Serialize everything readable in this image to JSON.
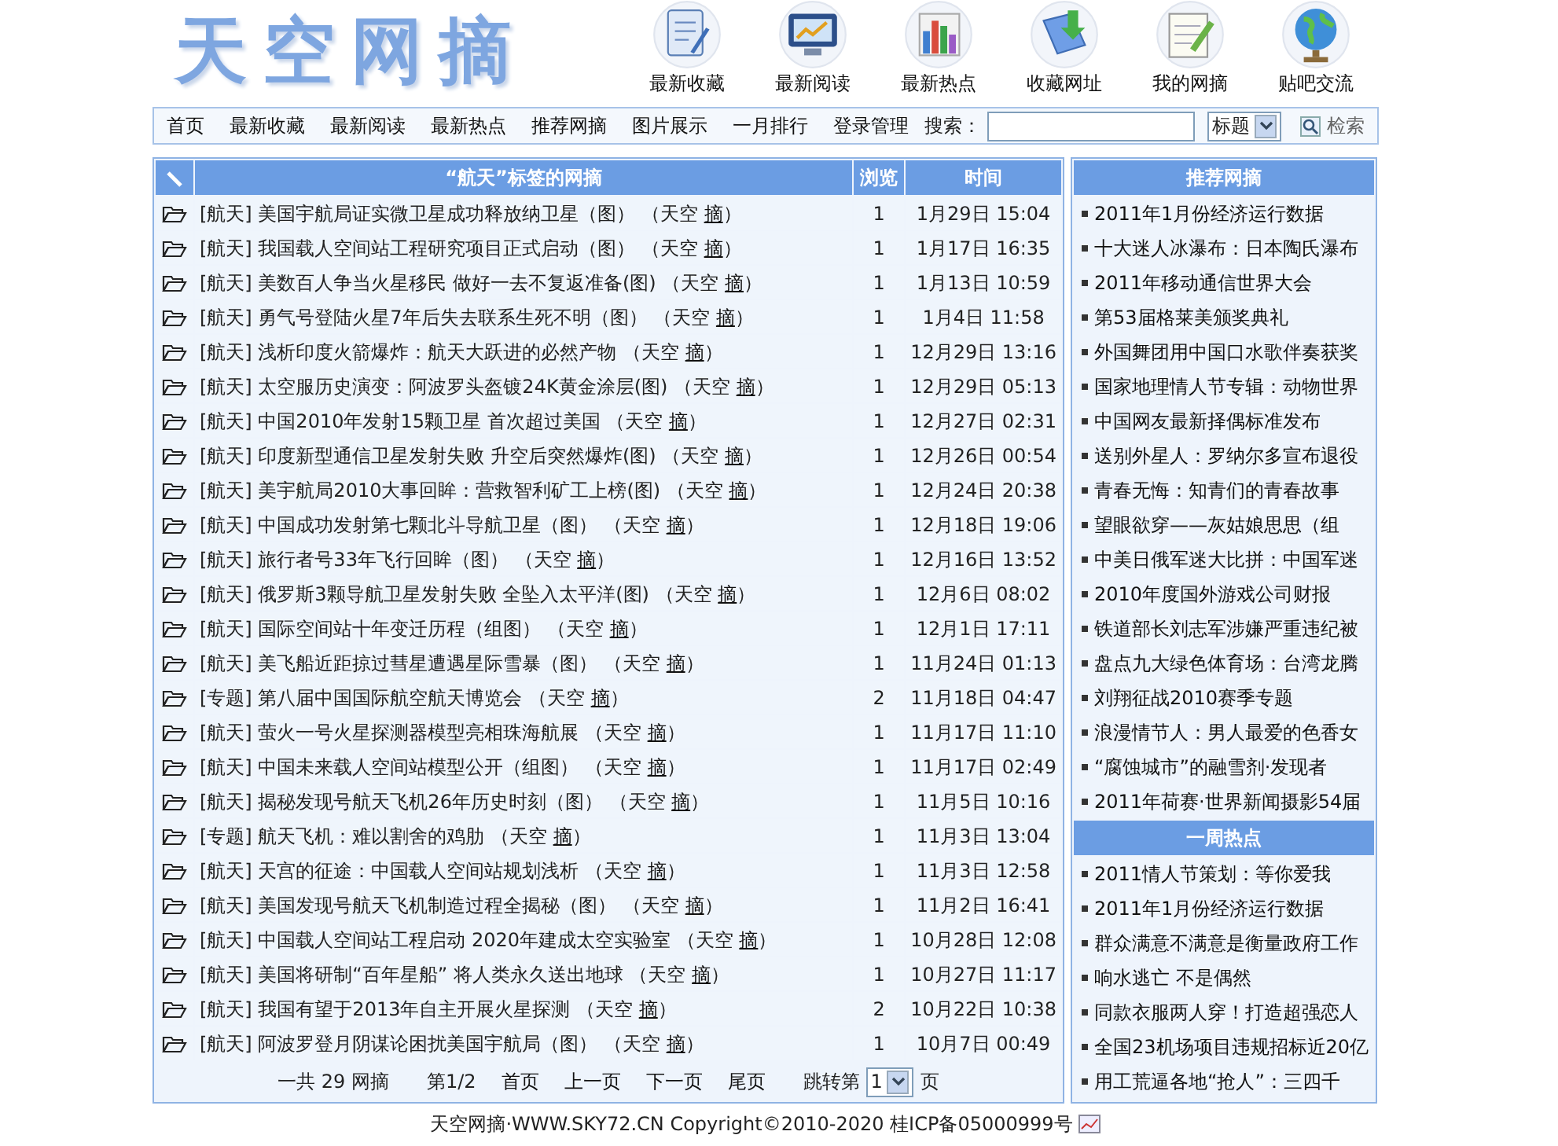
{
  "logo": "天空网摘",
  "quick_links": [
    {
      "label": "最新收藏",
      "kind": "clipboard"
    },
    {
      "label": "最新阅读",
      "kind": "monitor"
    },
    {
      "label": "最新热点",
      "kind": "bars"
    },
    {
      "label": "收藏网址",
      "kind": "download"
    },
    {
      "label": "我的网摘",
      "kind": "notepad"
    },
    {
      "label": "贴吧交流",
      "kind": "globe"
    }
  ],
  "nav": {
    "items": [
      "首页",
      "最新收藏",
      "最新阅读",
      "最新热点",
      "推荐网摘",
      "图片展示",
      "一月排行",
      "登录管理"
    ],
    "search_label": "搜索：",
    "search_scope": "标题",
    "search_button": "检索"
  },
  "table": {
    "columns": [
      "“航天”标签的网摘",
      "浏览",
      "时间"
    ],
    "rows": [
      {
        "title": "[航天] 美国宇航局证实微卫星成功释放纳卫星（图）",
        "credit": {
          "source": "（天空",
          "link": "摘",
          "close": "）"
        },
        "views": "1",
        "time": "1月29日 15:04"
      },
      {
        "title": "[航天] 我国载人空间站工程研究项目正式启动（图）",
        "credit": {
          "source": "（天空",
          "link": "摘",
          "close": "）"
        },
        "views": "1",
        "time": "1月17日 16:35"
      },
      {
        "title": "[航天] 美数百人争当火星移民 做好一去不复返准备(图)",
        "credit": {
          "source": "（天空",
          "link": "摘",
          "close": "）"
        },
        "views": "1",
        "time": "1月13日 10:59"
      },
      {
        "title": "[航天] 勇气号登陆火星7年后失去联系生死不明（图）",
        "credit": {
          "source": "（天空",
          "link": "摘",
          "close": "）"
        },
        "views": "1",
        "time": "1月4日 11:58"
      },
      {
        "title": "[航天] 浅析印度火箭爆炸：航天大跃进的必然产物",
        "credit": {
          "source": "（天空",
          "link": "摘",
          "close": "）"
        },
        "views": "1",
        "time": "12月29日 13:16"
      },
      {
        "title": "[航天] 太空服历史演变：阿波罗头盔镀24K黄金涂层(图)",
        "credit": {
          "source": "（天空",
          "link": "摘",
          "close": "）"
        },
        "views": "1",
        "time": "12月29日 05:13"
      },
      {
        "title": "[航天] 中国2010年发射15颗卫星 首次超过美国",
        "credit": {
          "source": "（天空",
          "link": "摘",
          "close": "）"
        },
        "views": "1",
        "time": "12月27日 02:31"
      },
      {
        "title": "[航天] 印度新型通信卫星发射失败 升空后突然爆炸(图)",
        "credit": {
          "source": "（天空",
          "link": "摘",
          "close": "）"
        },
        "views": "1",
        "time": "12月26日 00:54"
      },
      {
        "title": "[航天] 美宇航局2010大事回眸：营救智利矿工上榜(图)",
        "credit": {
          "source": "（天空",
          "link": "摘",
          "close": "）"
        },
        "views": "1",
        "time": "12月24日 20:38"
      },
      {
        "title": "[航天] 中国成功发射第七颗北斗导航卫星（图）",
        "credit": {
          "source": "（天空",
          "link": "摘",
          "close": "）"
        },
        "views": "1",
        "time": "12月18日 19:06"
      },
      {
        "title": "[航天] 旅行者号33年飞行回眸（图）",
        "credit": {
          "source": "（天空",
          "link": "摘",
          "close": "）"
        },
        "views": "1",
        "time": "12月16日 13:52"
      },
      {
        "title": "[航天] 俄罗斯3颗导航卫星发射失败 全坠入太平洋(图)",
        "credit": {
          "source": "（天空",
          "link": "摘",
          "close": "）"
        },
        "views": "1",
        "time": "12月6日 08:02"
      },
      {
        "title": "[航天] 国际空间站十年变迁历程（组图）",
        "credit": {
          "source": "（天空",
          "link": "摘",
          "close": "）"
        },
        "views": "1",
        "time": "12月1日 17:11"
      },
      {
        "title": "[航天] 美飞船近距掠过彗星遭遇星际雪暴（图）",
        "credit": {
          "source": "（天空",
          "link": "摘",
          "close": "）"
        },
        "views": "1",
        "time": "11月24日 01:13"
      },
      {
        "title": "[专题] 第八届中国国际航空航天博览会",
        "credit": {
          "source": "（天空",
          "link": "摘",
          "close": "）"
        },
        "views": "2",
        "time": "11月18日 04:47"
      },
      {
        "title": "[航天] 萤火一号火星探测器模型亮相珠海航展",
        "credit": {
          "source": "（天空",
          "link": "摘",
          "close": "）"
        },
        "views": "1",
        "time": "11月17日 11:10"
      },
      {
        "title": "[航天] 中国未来载人空间站模型公开（组图）",
        "credit": {
          "source": "（天空",
          "link": "摘",
          "close": "）"
        },
        "views": "1",
        "time": "11月17日 02:49"
      },
      {
        "title": "[航天] 揭秘发现号航天飞机26年历史时刻（图）",
        "credit": {
          "source": "（天空",
          "link": "摘",
          "close": "）"
        },
        "views": "1",
        "time": "11月5日 10:16"
      },
      {
        "title": "[专题] 航天飞机：难以割舍的鸡肋",
        "credit": {
          "source": "（天空",
          "link": "摘",
          "close": "）"
        },
        "views": "1",
        "time": "11月3日 13:04"
      },
      {
        "title": "[航天] 天宫的征途：中国载人空间站规划浅析",
        "credit": {
          "source": "（天空",
          "link": "摘",
          "close": "）"
        },
        "views": "1",
        "time": "11月3日 12:58"
      },
      {
        "title": "[航天] 美国发现号航天飞机制造过程全揭秘（图）",
        "credit": {
          "source": "（天空",
          "link": "摘",
          "close": "）"
        },
        "views": "1",
        "time": "11月2日 16:41"
      },
      {
        "title": "[航天] 中国载人空间站工程启动 2020年建成太空实验室",
        "credit": {
          "source": "（天空",
          "link": "摘",
          "close": "）"
        },
        "views": "1",
        "time": "10月28日 12:08"
      },
      {
        "title": "[航天] 美国将研制“百年星船” 将人类永久送出地球",
        "credit": {
          "source": "（天空",
          "link": "摘",
          "close": "）"
        },
        "views": "1",
        "time": "10月27日 11:17"
      },
      {
        "title": "[航天] 我国有望于2013年自主开展火星探测",
        "credit": {
          "source": "（天空",
          "link": "摘",
          "close": "）"
        },
        "views": "2",
        "time": "10月22日 10:38"
      },
      {
        "title": "[航天] 阿波罗登月阴谋论困扰美国宇航局（图）",
        "credit": {
          "source": "（天空",
          "link": "摘",
          "close": "）"
        },
        "views": "1",
        "time": "10月7日 00:49"
      }
    ],
    "pagination": {
      "total": "一共 29 网摘",
      "page": "第1/2",
      "links": [
        "首页",
        "上一页",
        "下一页",
        "尾页"
      ],
      "jump_label": "跳转第",
      "jump_value": "1",
      "jump_suffix": "页"
    }
  },
  "sidebar": [
    {
      "title": "推荐网摘",
      "items": [
        "2011年1月份经济运行数据",
        "十大迷人冰瀑布：日本陶氏瀑布",
        "2011年移动通信世界大会",
        "第53届格莱美颁奖典礼",
        "外国舞团用中国口水歌伴奏获奖",
        "国家地理情人节专辑：动物世界",
        "中国网友最新择偶标准发布",
        "送别外星人：罗纳尔多宣布退役",
        "青春无悔：知青们的青春故事",
        "望眼欲穿——灰姑娘思思（组",
        "中美日俄军迷大比拼：中国军迷",
        "2010年度国外游戏公司财报",
        "铁道部长刘志军涉嫌严重违纪被",
        "盘点九大绿色体育场：台湾龙腾",
        "刘翔征战2010赛季专题",
        "浪漫情节人：男人最爱的色香女",
        "“腐蚀城市”的融雪剂·发现者",
        "2011年荷赛·世界新闻摄影54届"
      ]
    },
    {
      "title": "一周热点",
      "items": [
        "2011情人节策划：等你爱我",
        "2011年1月份经济运行数据",
        "群众满意不满意是衡量政府工作",
        "响水逃亡 不是偶然",
        "同款衣服两人穿！打造超强恋人",
        "全国23机场项目违规招标近20亿",
        "用工荒逼各地“抢人”：三四千"
      ]
    }
  ],
  "footer": "天空网摘·WWW.SKY72.CN Copyright©2010-2020 桂ICP备05000999号"
}
